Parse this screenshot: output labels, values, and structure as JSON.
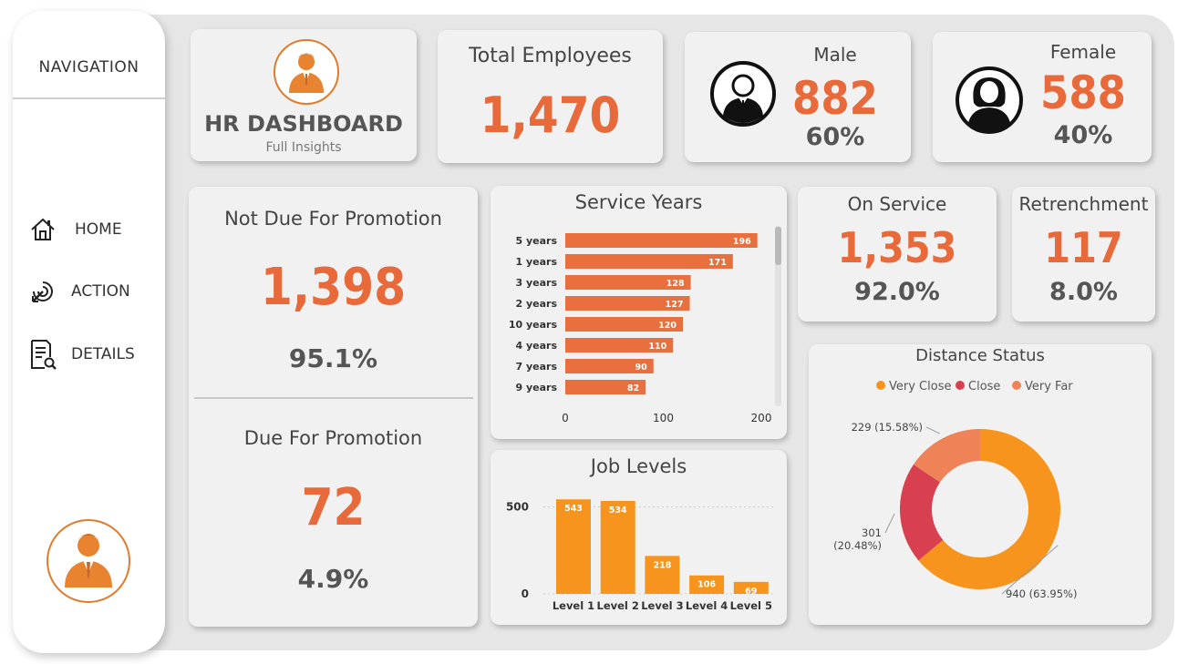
{
  "nav": {
    "title": "NAVIGATION",
    "items": [
      {
        "label": "HOME",
        "icon": "home-icon"
      },
      {
        "label": "ACTION",
        "icon": "action-icon"
      },
      {
        "label": "DETAILS",
        "icon": "details-icon"
      }
    ],
    "avatar_icon": "user-avatar-icon"
  },
  "header": {
    "title": "HR DASHBOARD",
    "subtitle": "Full Insights",
    "logo_icon": "businessman-icon"
  },
  "kpis": {
    "total": {
      "title": "Total Employees",
      "value": "1,470"
    },
    "male": {
      "title": "Male",
      "value": "882",
      "pct": "60%",
      "icon": "male-user-icon"
    },
    "female": {
      "title": "Female",
      "value": "588",
      "pct": "40%",
      "icon": "female-user-icon"
    },
    "on_service": {
      "title": "On Service",
      "value": "1,353",
      "pct": "92.0%"
    },
    "retrenchment": {
      "title": "Retrenchment",
      "value": "117",
      "pct": "8.0%"
    },
    "not_due": {
      "title": "Not Due For Promotion",
      "value": "1,398",
      "pct": "95.1%"
    },
    "due": {
      "title": "Due For Promotion",
      "value": "72",
      "pct": "4.9%"
    }
  },
  "colors": {
    "accent": "#e8693a",
    "bar_orange": "#e8703f",
    "level_orange": "#f7941d",
    "very_close": "#f7941d",
    "close": "#d8404f",
    "very_far": "#ef8358",
    "card": "#f1f1f1",
    "panel": "#e6e6e6"
  },
  "chart_data": [
    {
      "type": "bar",
      "title": "Service Years",
      "orientation": "horizontal",
      "categories": [
        "5 years",
        "1 years",
        "3 years",
        "2 years",
        "10 years",
        "4 years",
        "7 years",
        "9 years"
      ],
      "values": [
        196,
        171,
        128,
        127,
        120,
        110,
        90,
        82
      ],
      "xticks": [
        "0",
        "100",
        "200"
      ],
      "xlim": [
        0,
        200
      ]
    },
    {
      "type": "bar",
      "title": "Job Levels",
      "categories": [
        "Level 1",
        "Level 2",
        "Level 3",
        "Level 4",
        "Level 5"
      ],
      "values": [
        543,
        534,
        218,
        106,
        69
      ],
      "yticks": [
        "0",
        "500"
      ],
      "ylim": [
        0,
        560
      ]
    },
    {
      "type": "pie",
      "title": "Distance Status",
      "legend": [
        "Very Close",
        "Close",
        "Very Far"
      ],
      "values": [
        940,
        301,
        229
      ],
      "labels": [
        "940 (63.95%)",
        "301 (20.48%)",
        "229 (15.58%)"
      ],
      "legend_position": "top"
    }
  ]
}
